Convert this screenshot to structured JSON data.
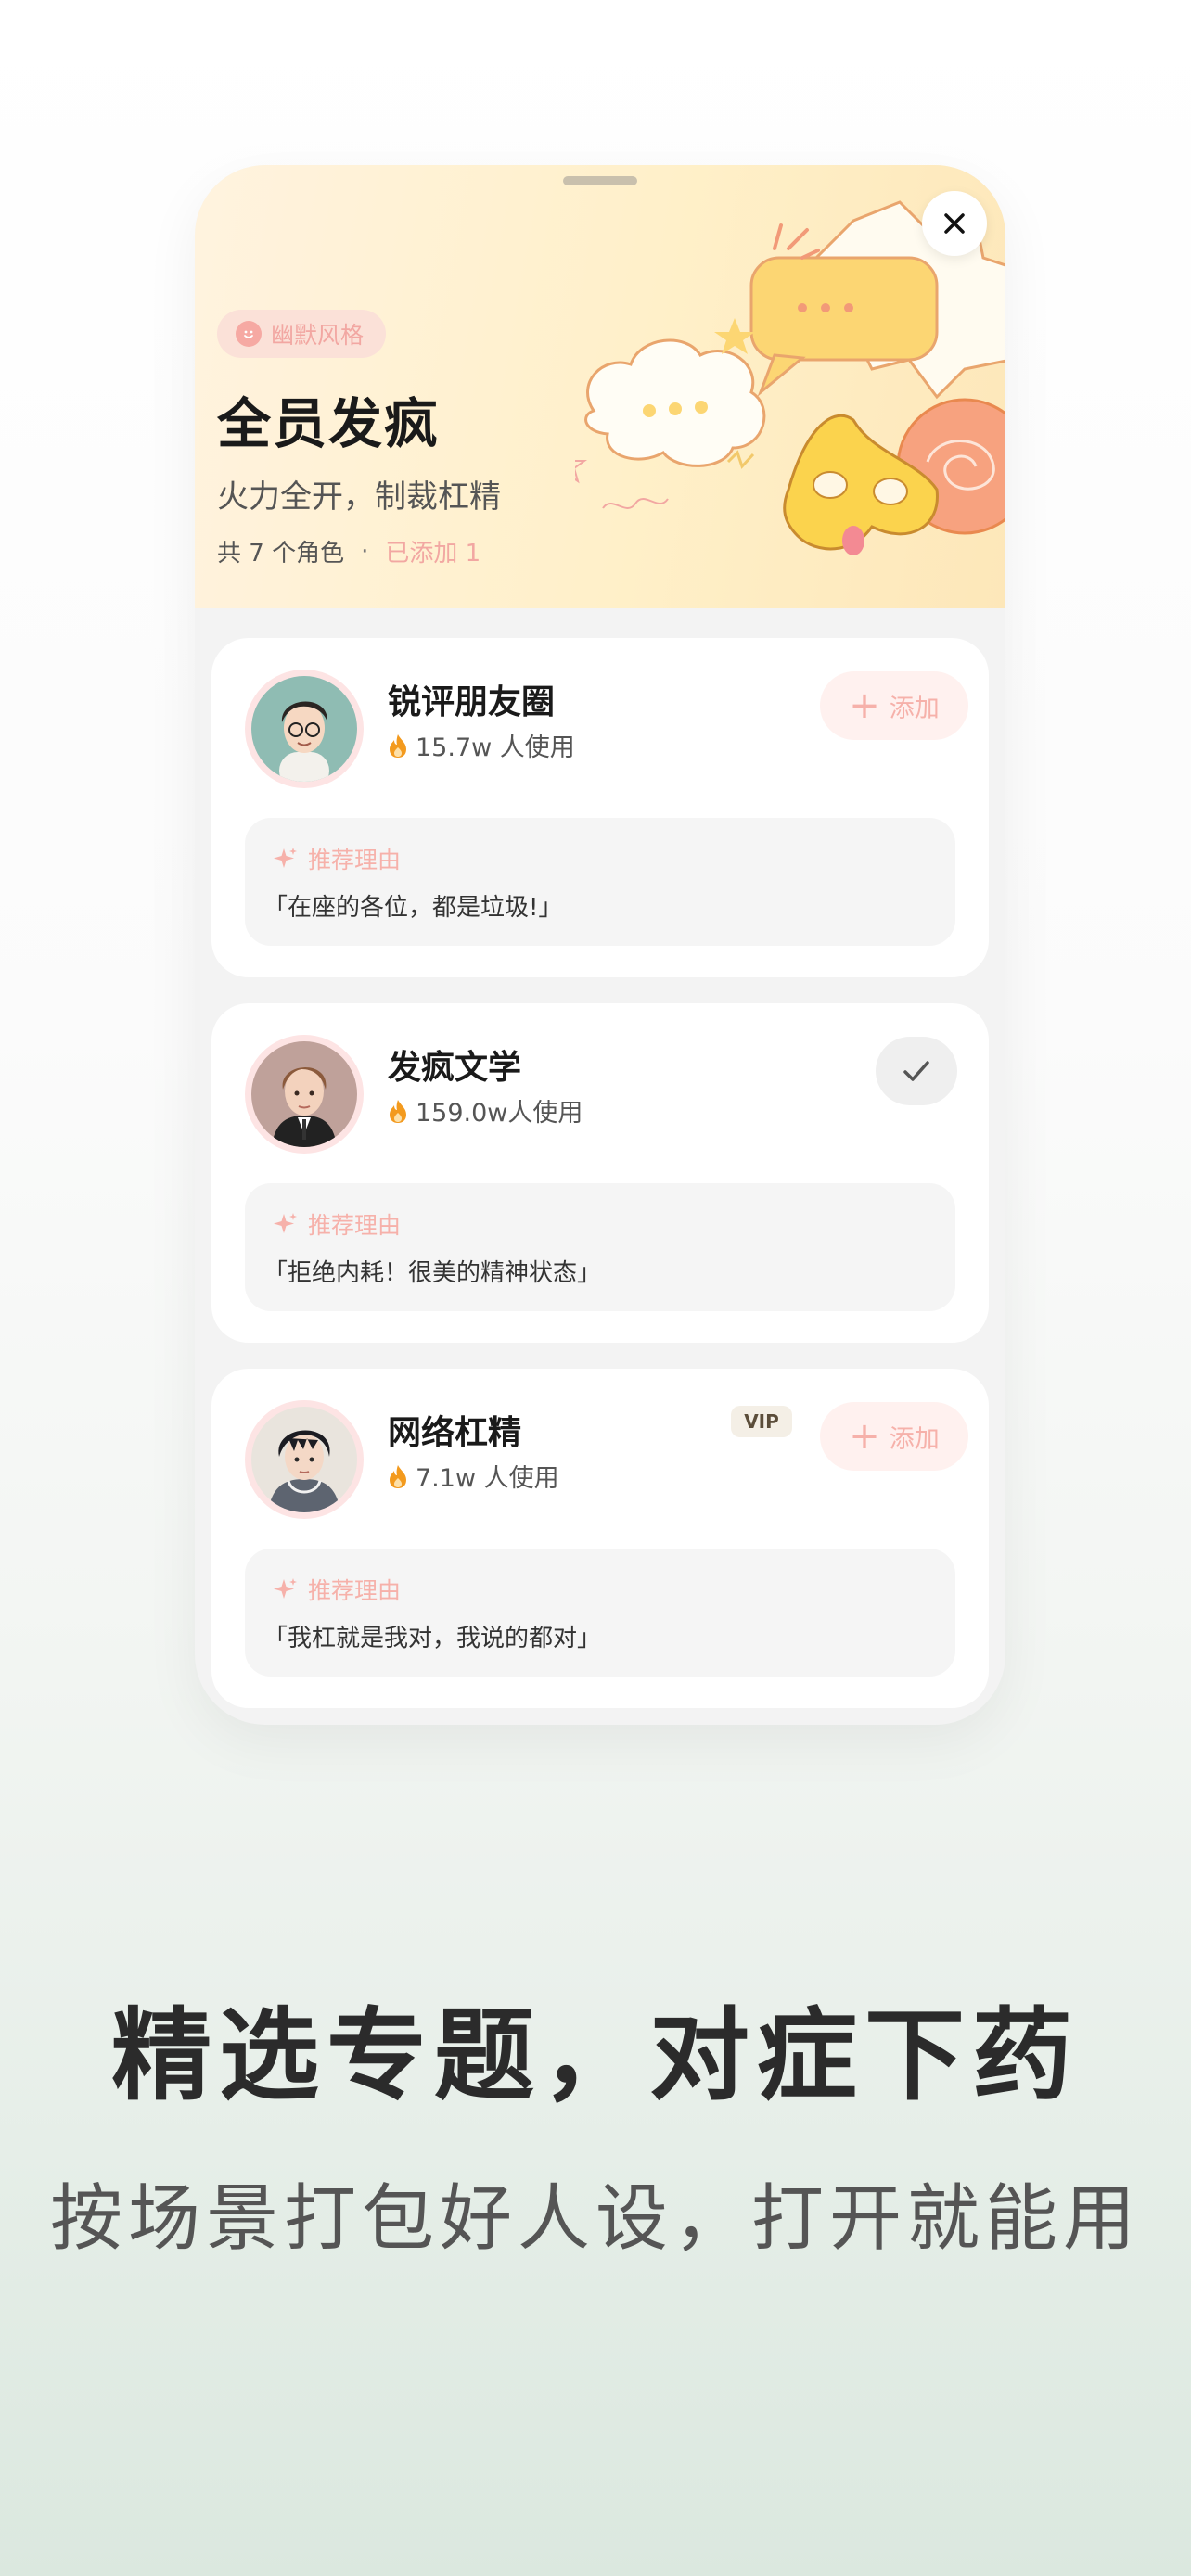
{
  "topic": {
    "style_tag": "幽默风格",
    "title": "全员发疯",
    "subtitle": "火力全开，制裁杠精",
    "role_count": "共 7 个角色",
    "separator": "·",
    "added_count": "已添加 1"
  },
  "roles": [
    {
      "name": "锐评朋友圈",
      "usage": "15.7w 人使用",
      "action": "添加",
      "added": false,
      "vip": false,
      "reason_label": "推荐理由",
      "reason": "「在座的各位，都是垃圾!」"
    },
    {
      "name": "发疯文学",
      "usage": "159.0w人使用",
      "action": "",
      "added": true,
      "vip": false,
      "reason_label": "推荐理由",
      "reason": "「拒绝内耗！很美的精神状态」"
    },
    {
      "name": "网络杠精",
      "usage": "7.1w 人使用",
      "action": "添加",
      "added": false,
      "vip": true,
      "vip_label": "VIP",
      "reason_label": "推荐理由",
      "reason": "「我杠就是我对，我说的都对」"
    }
  ],
  "promo": {
    "headline": "精选专题，对症下药",
    "subline": "按场景打包好人设，打开就能用"
  },
  "colors": {
    "accent": "#f2a7a2",
    "header_bg": "#fff0c9",
    "flame": "#f39a1e"
  },
  "icons": {
    "close": "close-icon",
    "flame": "flame-icon",
    "plus": "plus-icon",
    "check": "check-icon",
    "sparkle": "sparkle-icon",
    "smile": "smile-icon"
  }
}
